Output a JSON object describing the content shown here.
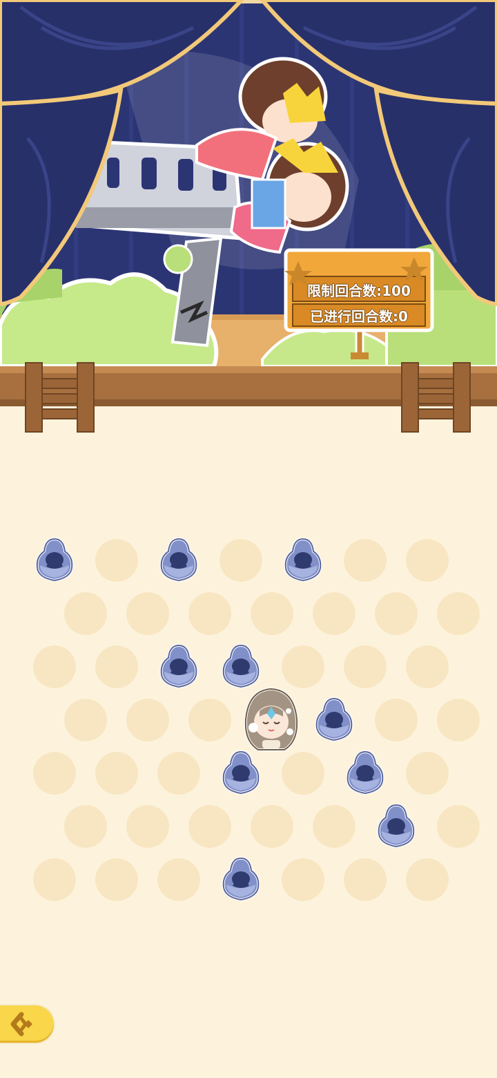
{
  "sign": {
    "round_limit": "限制回合数:100",
    "rounds_done": "已进行回合数:0"
  },
  "board": {
    "columns": 7,
    "rows": 7,
    "pieces": [
      [
        0,
        0
      ],
      [
        0,
        2
      ],
      [
        0,
        4
      ],
      [
        2,
        2
      ],
      [
        2,
        3
      ],
      [
        3,
        4
      ],
      [
        4,
        3
      ],
      [
        4,
        5
      ],
      [
        5,
        5
      ],
      [
        6,
        3
      ]
    ],
    "player": [
      3,
      3
    ]
  },
  "colors": {
    "background": "#fdf3dd",
    "empty_cell": "#f8e6c2",
    "piece": "#8190c8",
    "sign": "#f2a73b",
    "curtain": "#28306a",
    "back_button": "#f9d64a"
  },
  "icons": {
    "piece": "hooded-blob-icon",
    "player": "girl-character-icon",
    "back": "back-arrow-icon"
  }
}
